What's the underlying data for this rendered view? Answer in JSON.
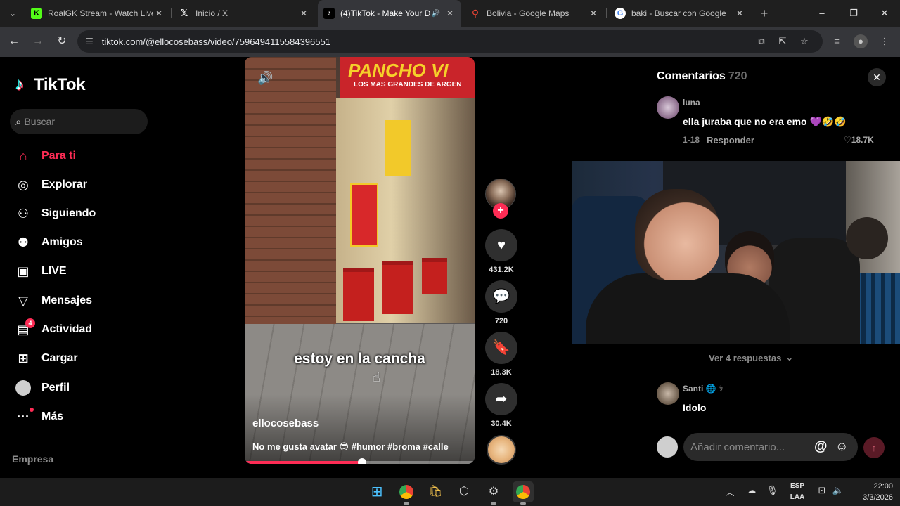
{
  "browser": {
    "tabs": [
      {
        "title": "RoalGK Stream - Watch Live",
        "favicon": "kick-icon",
        "color": "#53fc18"
      },
      {
        "title": "Inicio / X",
        "favicon": "x-icon",
        "color": "#000000"
      },
      {
        "title": "(4)TikTok - Make Your D",
        "favicon": "tiktok-icon",
        "color": "#000000"
      },
      {
        "title": "Bolivia - Google Maps",
        "favicon": "maps-icon",
        "color": "#34a853"
      },
      {
        "title": "baki - Buscar con Google",
        "favicon": "google-icon",
        "color": "#4285f4"
      }
    ],
    "active_tab_index": 2,
    "url": "tiktok.com/@ellocosebass/video/7596494115584396551"
  },
  "tiktok": {
    "logo_text": "TikTok",
    "search_placeholder": "Buscar",
    "nav": [
      {
        "label": "Para ti",
        "icon": "home-icon",
        "active": true
      },
      {
        "label": "Explorar",
        "icon": "compass-icon"
      },
      {
        "label": "Siguiendo",
        "icon": "following-icon"
      },
      {
        "label": "Amigos",
        "icon": "friends-icon"
      },
      {
        "label": "LIVE",
        "icon": "live-icon"
      },
      {
        "label": "Mensajes",
        "icon": "messages-icon"
      },
      {
        "label": "Actividad",
        "icon": "activity-icon",
        "badge": "4"
      },
      {
        "label": "Cargar",
        "icon": "upload-icon"
      },
      {
        "label": "Perfil",
        "icon": "profile-avatar"
      },
      {
        "label": "Más",
        "icon": "more-icon"
      }
    ],
    "footer_section": "Empresa"
  },
  "video": {
    "store_sign": "PANCHO VI",
    "store_subsign": "LOS MAS GRANDES DE ARGEN",
    "caption": "estoy en la cancha",
    "author": "ellocosebass",
    "description": "No me gusta avatar 😎 #humor #broma #calle",
    "progress": 0.51,
    "stats": {
      "likes": "431.2K",
      "comments": "720",
      "saves": "18.3K",
      "shares": "30.4K"
    }
  },
  "comments": {
    "title": "Comentarios",
    "count": "720",
    "items": [
      {
        "user": "luna",
        "text": "ella juraba que no era emo 💜🤣🤣",
        "date": "1-18",
        "reply": "Responder",
        "likes": "18.7K"
      },
      {
        "user": "Santi 🌐 ⚕",
        "text": "Idolo"
      }
    ],
    "more_replies": "Ver 4 respuestas",
    "input_placeholder": "Añadir comentario..."
  },
  "taskbar": {
    "lang_line1": "ESP",
    "lang_line2": "LAA",
    "time": "22:00",
    "date": "3/3/2026"
  }
}
